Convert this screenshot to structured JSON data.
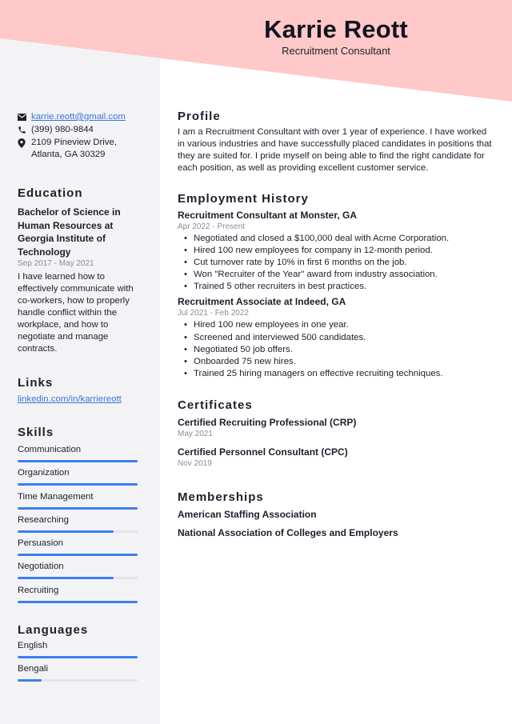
{
  "header": {
    "name": "Karrie Reott",
    "title": "Recruitment Consultant",
    "band_color": "#ffc9c9"
  },
  "contact": {
    "email": "karrie.reott@gmail.com",
    "phone": "(399) 980-9844",
    "address": "2109 Pineview Drive, Atlanta, GA 30329",
    "icons": [
      "envelope-icon",
      "phone-icon",
      "map-pin-icon"
    ]
  },
  "education": {
    "heading": "Education",
    "degree": "Bachelor of Science in Human Resources at Georgia Institute of Technology",
    "dates": "Sep 2017 - May 2021",
    "description": "I have learned how to effectively communicate with co-workers, how to properly handle conflict within the workplace, and how to negotiate and manage contracts."
  },
  "links": {
    "heading": "Links",
    "items": [
      "linkedin.com/in/karriereott"
    ]
  },
  "skills": {
    "heading": "Skills",
    "items": [
      {
        "label": "Communication",
        "level": 100
      },
      {
        "label": "Organization",
        "level": 100
      },
      {
        "label": "Time Management",
        "level": 100
      },
      {
        "label": "Researching",
        "level": 80
      },
      {
        "label": "Persuasion",
        "level": 100
      },
      {
        "label": "Negotiation",
        "level": 80
      },
      {
        "label": "Recruiting",
        "level": 100
      }
    ]
  },
  "languages": {
    "heading": "Languages",
    "items": [
      {
        "label": "English",
        "level": 100
      },
      {
        "label": "Bengali",
        "level": 20
      }
    ]
  },
  "profile": {
    "heading": "Profile",
    "text": "I am a Recruitment Consultant with over 1 year of experience. I have worked in various industries and have successfully placed candidates in positions that they are suited for. I pride myself on being able to find the right candidate for each position, as well as providing excellent customer service."
  },
  "employment": {
    "heading": "Employment History",
    "jobs": [
      {
        "title": "Recruitment Consultant at Monster, GA",
        "dates": "Apr 2022 - Present",
        "bullets": [
          "Negotiated and closed a $100,000 deal with Acme Corporation.",
          "Hired 100 new employees for company in 12-month period.",
          "Cut turnover rate by 10% in first 6 months on the job.",
          "Won \"Recruiter of the Year\" award from industry association.",
          "Trained 5 other recruiters in best practices."
        ]
      },
      {
        "title": "Recruitment Associate at Indeed, GA",
        "dates": "Jul 2021 - Feb 2022",
        "bullets": [
          "Hired 100 new employees in one year.",
          "Screened and interviewed 500 candidates.",
          "Negotiated 50 job offers.",
          "Onboarded 75 new hires.",
          "Trained 25 hiring managers on effective recruiting techniques."
        ]
      }
    ]
  },
  "certificates": {
    "heading": "Certificates",
    "items": [
      {
        "title": "Certified Recruiting Professional (CRP)",
        "date": "May 2021"
      },
      {
        "title": "Certified Personnel Consultant (CPC)",
        "date": "Nov 2019"
      }
    ]
  },
  "memberships": {
    "heading": "Memberships",
    "items": [
      "American Staffing Association",
      "National Association of Colleges and Employers"
    ]
  },
  "colors": {
    "accent_bar": "#3a7ff0",
    "link": "#3a74d8",
    "sidebar_bg": "#f3f3f6"
  }
}
